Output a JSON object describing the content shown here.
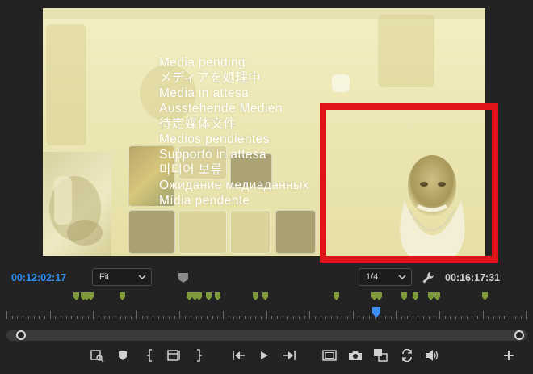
{
  "monitor": {
    "pending_messages": [
      "Media pending",
      "メディアを処理中",
      "Media in attesa",
      "Ausstehende Medien",
      "待定媒体文件",
      "Medios pendientes",
      "Supporto in attesa",
      "미디어 보류",
      "Ожидание медиаданных",
      "Mídia pendente"
    ]
  },
  "controls": {
    "current_timecode": "00:12:02:17",
    "zoom_select": "Fit",
    "resolution_select": "1/4",
    "duration_timecode": "00:16:17:31"
  },
  "colors": {
    "timecode_current": "#2f8ff0",
    "highlight_box": "#e0151a",
    "marker_green": "#7f9a3a",
    "playhead_blue": "#3d8ff5"
  },
  "icons": [
    "add-marker-icon",
    "settings-wrench-icon",
    "insert-edit-icon",
    "marker-icon",
    "mark-in-icon",
    "clip-edit-icon",
    "mark-out-icon",
    "go-to-in-icon",
    "play-icon",
    "go-to-out-icon",
    "safe-margins-icon",
    "export-frame-icon",
    "comparison-view-icon",
    "multi-camera-icon",
    "audio-icon",
    "button-editor-icon"
  ]
}
